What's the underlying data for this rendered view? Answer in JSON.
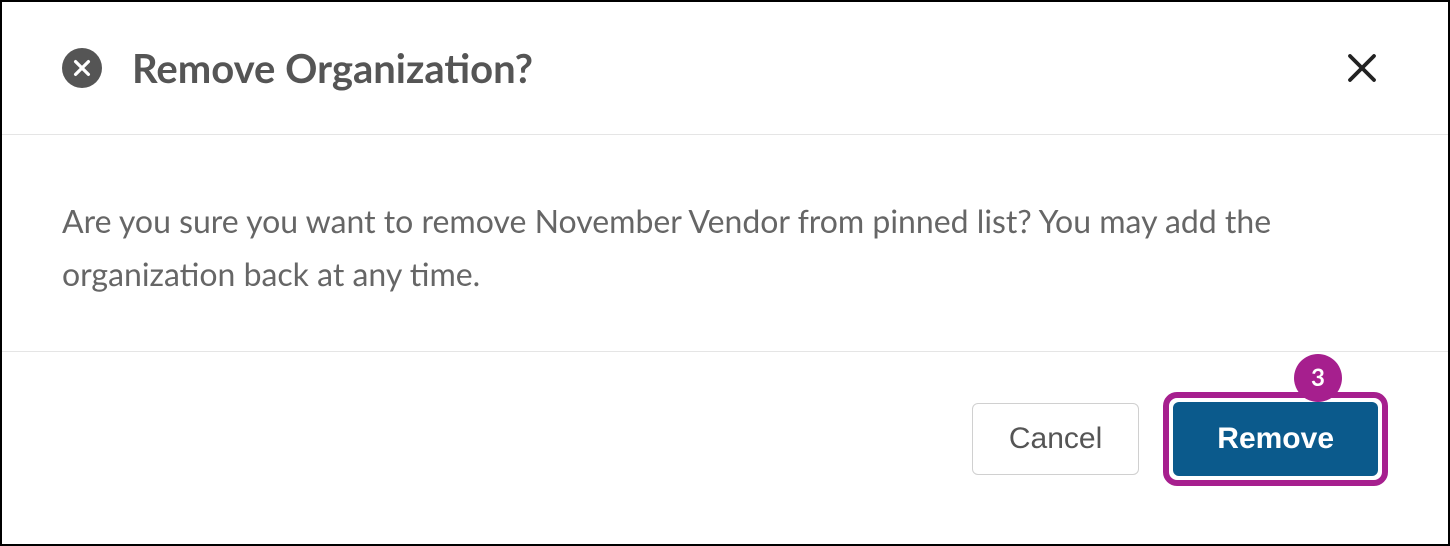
{
  "dialog": {
    "title": "Remove Organization?",
    "message": "Are you sure you want to remove November Vendor from pinned list? You may add the organization back at any time.",
    "cancel_label": "Cancel",
    "confirm_label": "Remove"
  },
  "annotation": {
    "step_number": "3"
  },
  "icons": {
    "header_icon": "times-circle-icon",
    "close_icon": "close-icon"
  },
  "colors": {
    "accent_purple": "#a61f8e",
    "primary_blue": "#0b5a8c",
    "text_gray": "#555"
  }
}
